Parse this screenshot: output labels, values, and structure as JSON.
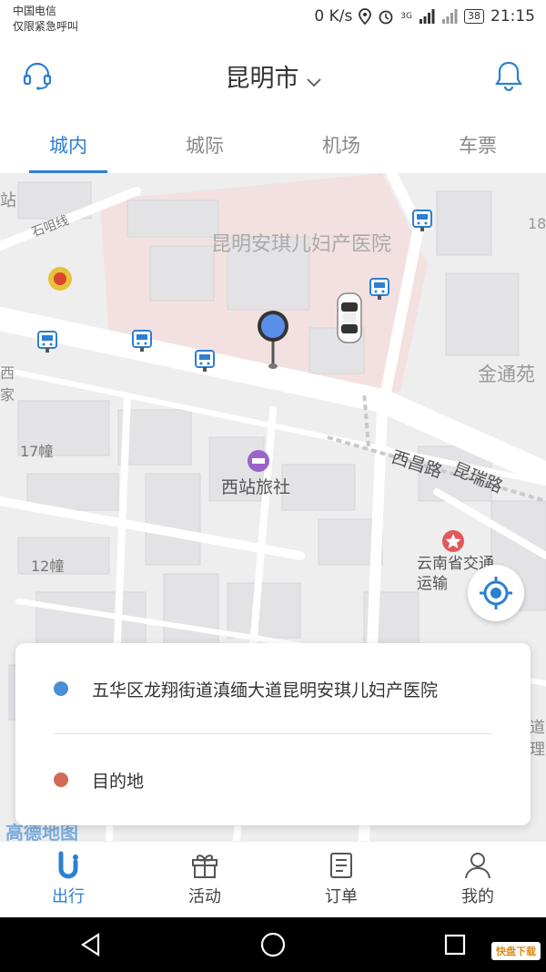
{
  "status_bar": {
    "carrier": "中国电信",
    "carrier_note": "仅限紧急呼叫",
    "speed": "0 K/s",
    "network": "3G",
    "battery": "38",
    "time": "21:15"
  },
  "header": {
    "city": "昆明市",
    "support_icon": "headset-icon",
    "notify_icon": "bell-icon"
  },
  "tabs": [
    {
      "label": "城内",
      "active": true
    },
    {
      "label": "城际",
      "active": false
    },
    {
      "label": "机场",
      "active": false
    },
    {
      "label": "车票",
      "active": false
    }
  ],
  "map": {
    "labels": {
      "hospital": "昆明安琪儿妇产医院",
      "hotel": "西站旅社",
      "road1": "西昌路",
      "road2": "昆瑞路",
      "building17": "17幢",
      "building12": "12幢",
      "jintong": "金通苑",
      "yunnan": "云南省交通运输",
      "shiju": "石咀线",
      "num18": "18",
      "edge_left1": "站",
      "edge_left2": "西",
      "edge_left3": "家",
      "edge_right1": "道",
      "edge_right2": "理",
      "logo": "高德地图"
    }
  },
  "card": {
    "origin": "五华区龙翔街道滇缅大道昆明安琪儿妇产医院",
    "destination_placeholder": "目的地",
    "origin_color": "#4a8fd6",
    "destination_color": "#d46a55"
  },
  "bottom_nav": [
    {
      "label": "出行",
      "icon": "travel-icon",
      "active": true
    },
    {
      "label": "活动",
      "icon": "gift-icon",
      "active": false
    },
    {
      "label": "订单",
      "icon": "order-icon",
      "active": false
    },
    {
      "label": "我的",
      "icon": "user-icon",
      "active": false
    }
  ],
  "watermark": "快盘下载"
}
